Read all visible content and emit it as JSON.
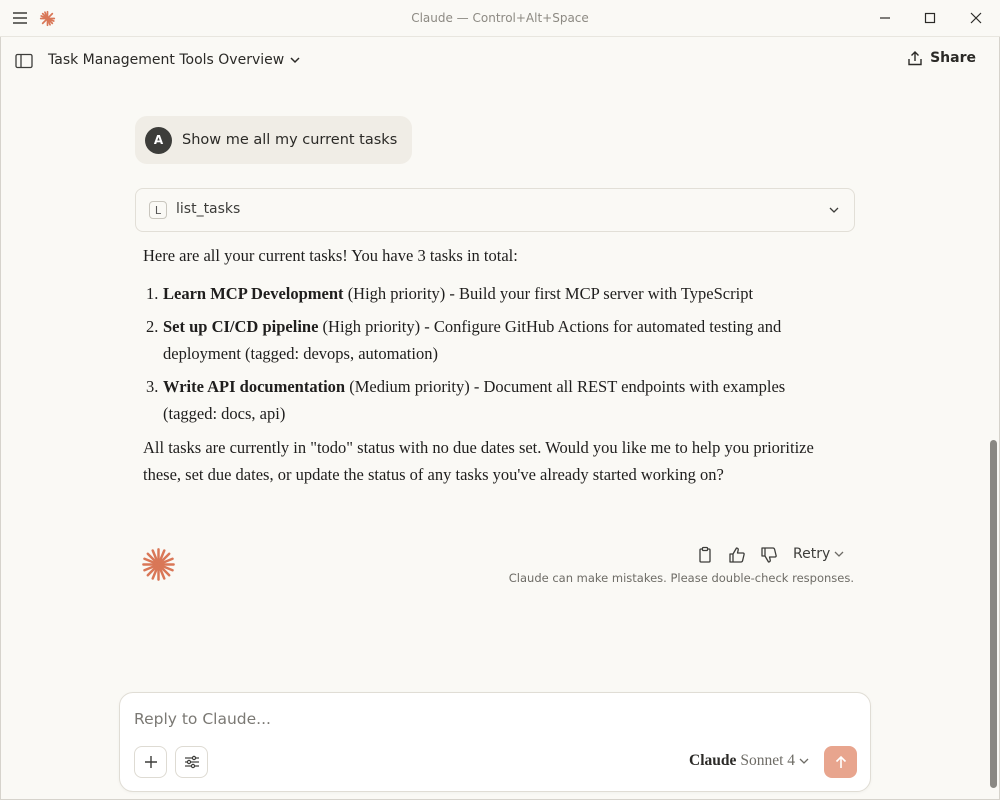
{
  "window": {
    "title": "Claude — Control+Alt+Space"
  },
  "header": {
    "conversation_title": "Task Management Tools Overview",
    "share_label": "Share"
  },
  "conversation": {
    "user_message": {
      "avatar_initial": "A",
      "text": "Show me all my current tasks"
    },
    "tool_call": {
      "badge": "L",
      "name": "list_tasks"
    },
    "response": {
      "intro": "Here are all your current tasks! You have 3 tasks in total:",
      "tasks": [
        {
          "number": "1.",
          "title": "Learn MCP Development",
          "detail": " (High priority) - Build your first MCP server with TypeScript"
        },
        {
          "number": "2.",
          "title": "Set up CI/CD pipeline",
          "detail": " (High priority) - Configure GitHub Actions for automated testing and deployment (tagged: devops, automation)"
        },
        {
          "number": "3.",
          "title": "Write API documentation",
          "detail": " (Medium priority) - Document all REST endpoints with examples (tagged: docs, api)"
        }
      ],
      "closing": "All tasks are currently in \"todo\" status with no due dates set. Would you like me to help you prioritize these, set due dates, or update the status of any tasks you've already started working on?"
    },
    "actions": {
      "retry_label": "Retry",
      "disclaimer": "Claude can make mistakes. Please double-check responses."
    }
  },
  "composer": {
    "placeholder": "Reply to Claude...",
    "value": "",
    "model_brand": "Claude",
    "model_name": "Sonnet 4"
  },
  "colors": {
    "accent": "#d97757",
    "send_button": "#e8a58e",
    "background": "#faf9f5",
    "user_bubble": "#f0ede6"
  },
  "icons": {
    "menu": "hamburger-menu-icon",
    "logo": "claude-starburst-icon",
    "sidebar": "sidebar-toggle-icon",
    "share": "share-upload-icon",
    "copy": "clipboard-icon",
    "thumbs_up": "thumbs-up-icon",
    "thumbs_down": "thumbs-down-icon",
    "add": "plus-icon",
    "tools": "sliders-icon",
    "send": "arrow-up-icon"
  }
}
